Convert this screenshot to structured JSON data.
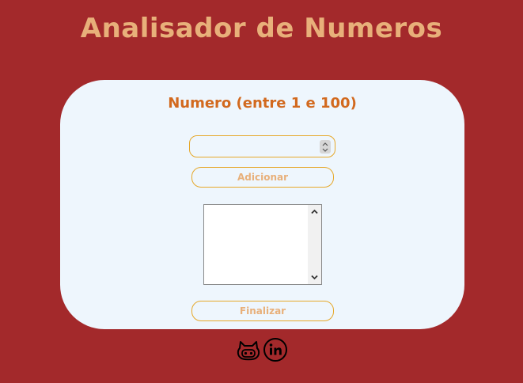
{
  "page": {
    "title": "Analisador de Numeros"
  },
  "form": {
    "heading": "Numero (entre 1 e 100)",
    "number_input": {
      "value": "",
      "placeholder": ""
    },
    "add_button_label": "Adicionar",
    "list_items": [],
    "finish_button_label": "Finalizar"
  },
  "footer": {
    "icons": [
      "github-icon",
      "linkedin-icon"
    ]
  },
  "colors": {
    "background": "#a3292b",
    "title": "#e8b07a",
    "card": "#eef6fd",
    "heading": "#d2691e",
    "border_accent": "#e6a82a"
  }
}
